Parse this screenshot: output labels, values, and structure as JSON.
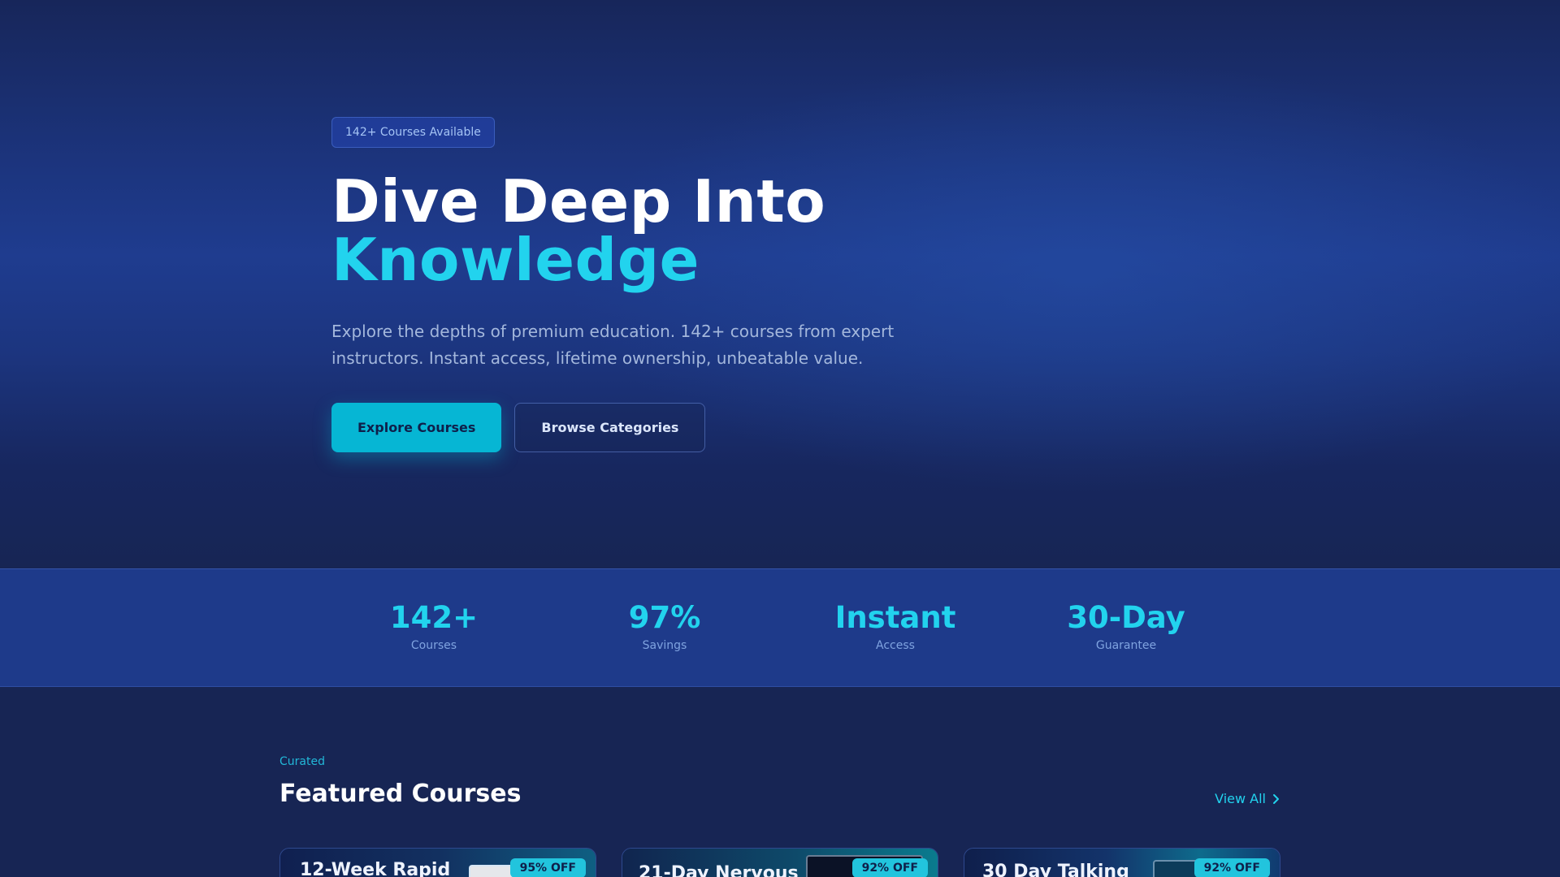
{
  "hero": {
    "badge": "142+ Courses Available",
    "headline_line1": "Dive Deep Into",
    "headline_line2": "Knowledge",
    "subtitle": "Explore the depths of premium education. 142+ courses from expert instructors. Instant access, lifetime ownership, unbeatable value.",
    "primary_cta": "Explore Courses",
    "secondary_cta": "Browse Categories"
  },
  "stats": [
    {
      "value": "142+",
      "label": "Courses"
    },
    {
      "value": "97%",
      "label": "Savings"
    },
    {
      "value": "Instant",
      "label": "Access"
    },
    {
      "value": "30-Day",
      "label": "Guarantee"
    }
  ],
  "featured": {
    "eyebrow": "Curated",
    "title": "Featured Courses",
    "view_all": "View All",
    "cards": [
      {
        "title": "12-Week Rapid",
        "discount": "95% OFF"
      },
      {
        "title": "21-Day Nervous",
        "discount": "92% OFF"
      },
      {
        "title": "30 Day Talking",
        "discount": "92% OFF"
      }
    ]
  },
  "colors": {
    "accent": "#22d3ee",
    "primary_button": "#06b6d4",
    "background": "#172554",
    "stats_band": "#1e3a8a"
  }
}
